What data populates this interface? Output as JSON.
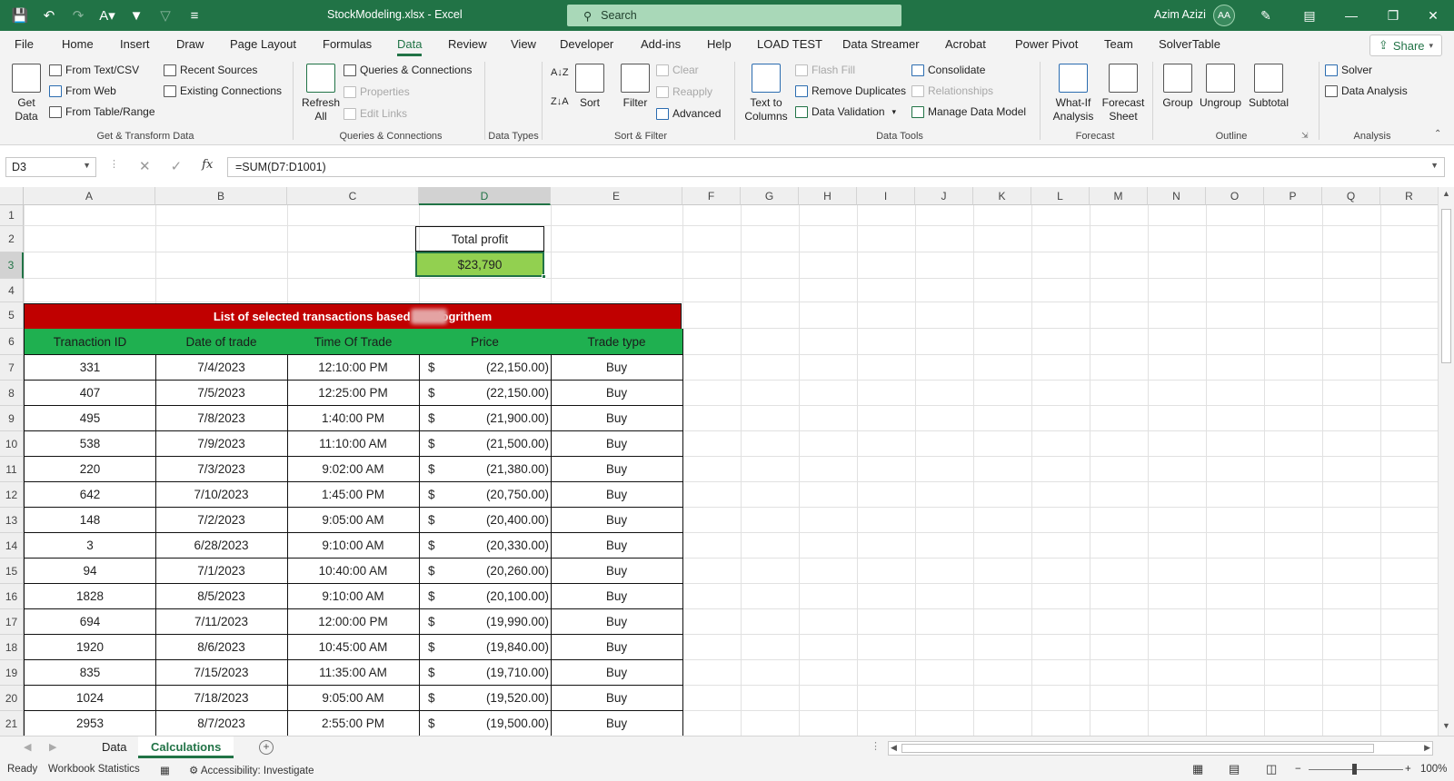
{
  "titlebar": {
    "filename": "StockModeling.xlsx  -  Excel",
    "search_placeholder": "Search",
    "user": "Azim Azizi",
    "avatar": "AA"
  },
  "menu": {
    "tabs": [
      "File",
      "Home",
      "Insert",
      "Draw",
      "Page Layout",
      "Formulas",
      "Data",
      "Review",
      "View",
      "Developer",
      "Add-ins",
      "Help",
      "LOAD TEST",
      "Data Streamer",
      "Acrobat",
      "Power Pivot",
      "Team",
      "SolverTable"
    ],
    "active": "Data",
    "share": "Share"
  },
  "ribbon": {
    "get_data": "Get Data",
    "from_text_csv": "From Text/CSV",
    "from_web": "From Web",
    "from_table_range": "From Table/Range",
    "recent_sources": "Recent Sources",
    "existing_connections": "Existing Connections",
    "group_get_transform": "Get & Transform Data",
    "refresh_all": "Refresh All",
    "queries_connections": "Queries & Connections",
    "properties": "Properties",
    "edit_links": "Edit Links",
    "group_queries": "Queries & Connections",
    "group_data_types": "Data Types",
    "sort": "Sort",
    "filter": "Filter",
    "clear": "Clear",
    "reapply": "Reapply",
    "advanced": "Advanced",
    "group_sort_filter": "Sort & Filter",
    "text_to_columns": "Text to Columns",
    "flash_fill": "Flash Fill",
    "remove_duplicates": "Remove Duplicates",
    "data_validation": "Data Validation",
    "consolidate": "Consolidate",
    "relationships": "Relationships",
    "manage_data_model": "Manage Data Model",
    "group_data_tools": "Data Tools",
    "what_if": "What-If Analysis",
    "forecast_sheet": "Forecast Sheet",
    "group_forecast": "Forecast",
    "group_btn": "Group",
    "ungroup": "Ungroup",
    "subtotal": "Subtotal",
    "group_outline": "Outline",
    "solver": "Solver",
    "data_analysis": "Data Analysis",
    "group_analysis": "Analysis"
  },
  "formula_bar": {
    "name_box": "D3",
    "formula": "=SUM(D7:D1001)",
    "fx": "fx"
  },
  "sheet": {
    "columns": [
      "A",
      "B",
      "C",
      "D",
      "E",
      "F",
      "G",
      "H",
      "I",
      "J",
      "K",
      "L",
      "M",
      "N",
      "O",
      "P",
      "Q",
      "R"
    ],
    "selected_column": "D",
    "rows": [
      "1",
      "2",
      "3",
      "4",
      "5",
      "6",
      "7",
      "8",
      "9",
      "10",
      "11",
      "12",
      "13",
      "14",
      "15",
      "16",
      "17",
      "18",
      "19",
      "20",
      "21"
    ],
    "selected_row": "3",
    "total_label": "Total profit",
    "total_value": "$23,790",
    "banner": "List of selected transactions based on          alogrithem",
    "headers": [
      "Tranaction ID",
      "Date of trade",
      "Time Of Trade",
      "Price",
      "Trade type"
    ],
    "currency": "$",
    "transactions": [
      [
        "331",
        "7/4/2023",
        "12:10:00 PM",
        "(22,150.00)",
        "Buy"
      ],
      [
        "407",
        "7/5/2023",
        "12:25:00 PM",
        "(22,150.00)",
        "Buy"
      ],
      [
        "495",
        "7/8/2023",
        "1:40:00 PM",
        "(21,900.00)",
        "Buy"
      ],
      [
        "538",
        "7/9/2023",
        "11:10:00 AM",
        "(21,500.00)",
        "Buy"
      ],
      [
        "220",
        "7/3/2023",
        "9:02:00 AM",
        "(21,380.00)",
        "Buy"
      ],
      [
        "642",
        "7/10/2023",
        "1:45:00 PM",
        "(20,750.00)",
        "Buy"
      ],
      [
        "148",
        "7/2/2023",
        "9:05:00 AM",
        "(20,400.00)",
        "Buy"
      ],
      [
        "3",
        "6/28/2023",
        "9:10:00 AM",
        "(20,330.00)",
        "Buy"
      ],
      [
        "94",
        "7/1/2023",
        "10:40:00 AM",
        "(20,260.00)",
        "Buy"
      ],
      [
        "1828",
        "8/5/2023",
        "9:10:00 AM",
        "(20,100.00)",
        "Buy"
      ],
      [
        "694",
        "7/11/2023",
        "12:00:00 PM",
        "(19,990.00)",
        "Buy"
      ],
      [
        "1920",
        "8/6/2023",
        "10:45:00 AM",
        "(19,840.00)",
        "Buy"
      ],
      [
        "835",
        "7/15/2023",
        "11:35:00 AM",
        "(19,710.00)",
        "Buy"
      ],
      [
        "1024",
        "7/18/2023",
        "9:05:00 AM",
        "(19,520.00)",
        "Buy"
      ],
      [
        "2953",
        "8/7/2023",
        "2:55:00 PM",
        "(19,500.00)",
        "Buy"
      ]
    ]
  },
  "sheet_tabs": {
    "tabs": [
      "Data",
      "Calculations"
    ],
    "active": "Calculations"
  },
  "status": {
    "ready": "Ready",
    "workbook_statistics": "Workbook Statistics",
    "accessibility": "Accessibility: Investigate",
    "zoom": "100%"
  },
  "colors": {
    "excel_green": "#217346",
    "banner_red": "#c00000",
    "header_green": "#1fb050",
    "total_green": "#92d050"
  }
}
